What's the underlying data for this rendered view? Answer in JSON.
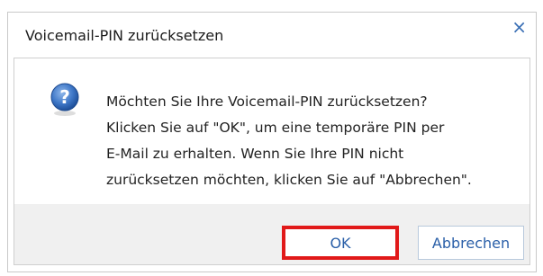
{
  "dialog": {
    "title": "Voicemail-PIN zurücksetzen",
    "close_glyph": "×",
    "icon": "question-icon",
    "message_lines": [
      "Möchten Sie Ihre Voicemail-PIN zurücksetzen?",
      "Klicken Sie auf \"OK\", um eine temporäre PIN per",
      "E-Mail zu erhalten. Wenn Sie Ihre PIN nicht",
      "zurücksetzen möchten, klicken Sie auf \"Abbrechen\"."
    ],
    "buttons": {
      "ok_label": "OK",
      "cancel_label": "Abbrechen"
    }
  },
  "colors": {
    "accent": "#2a5fa8",
    "highlight": "#e11919",
    "footer_bg": "#f0f0f0"
  }
}
